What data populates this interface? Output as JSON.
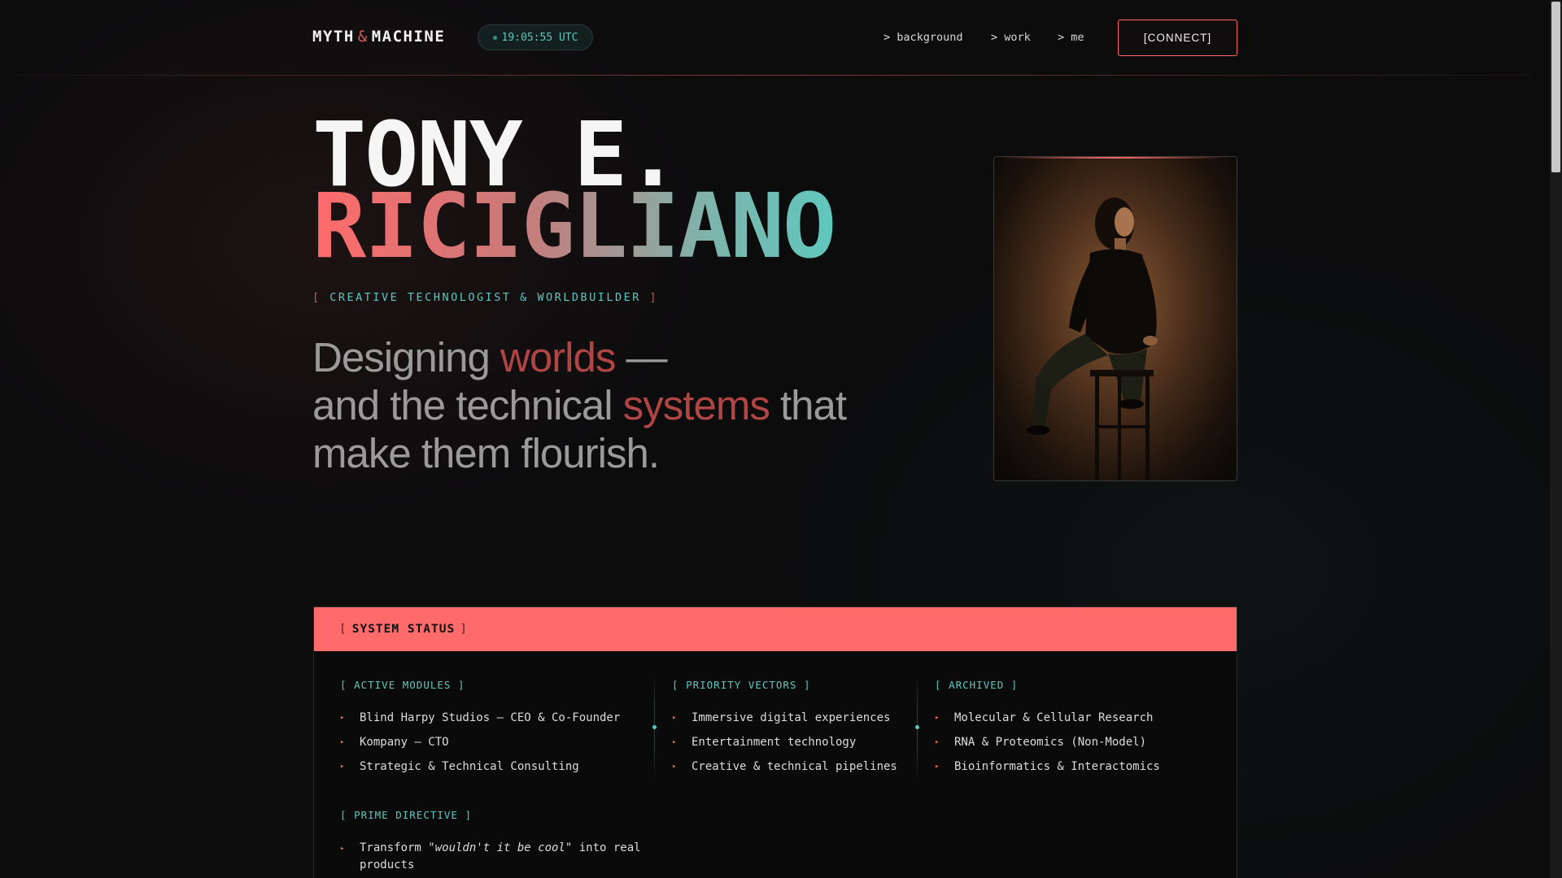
{
  "header": {
    "logo_left": "MYTH",
    "logo_amp": "&",
    "logo_right": "MACHINE",
    "clock": "19:05:55 UTC",
    "nav": [
      "> background",
      "> work",
      "> me"
    ],
    "connect_label": "[CONNECT]"
  },
  "hero": {
    "name_first": "TONY E.",
    "name_last": "RICIGLIANO",
    "subtitle_open": "[",
    "subtitle": "CREATIVE TECHNOLOGIST & WORLDBUILDER",
    "subtitle_close": "]",
    "tagline": {
      "p1": "Designing ",
      "hl1": "worlds",
      "p2": " —",
      "p3": "and the technical ",
      "hl2": "systems",
      "p4": " that",
      "p5": "make them flourish."
    }
  },
  "status": {
    "title": "SYSTEM STATUS",
    "active_modules": {
      "label": "ACTIVE MODULES",
      "items": [
        "Blind Harpy Studios — CEO & Co-Founder",
        "Kompany — CTO",
        "Strategic & Technical Consulting"
      ]
    },
    "priority_vectors": {
      "label": "PRIORITY VECTORS",
      "items": [
        "Immersive digital experiences",
        "Entertainment technology",
        "Creative & technical pipelines"
      ]
    },
    "archived": {
      "label": "ARCHIVED",
      "items": [
        "Molecular & Cellular Research",
        "RNA & Proteomics (Non-Model)",
        "Bioinformatics & Interactomics"
      ]
    },
    "prime_directive": {
      "label": "PRIME DIRECTIVE",
      "pre": "Transform \"",
      "em": "wouldn't it be cool",
      "post": "\" into real",
      "line2": "products"
    }
  },
  "colors": {
    "accent_red": "#ff6b6b",
    "accent_teal": "#5fc7be",
    "background": "#0c0c0d"
  }
}
